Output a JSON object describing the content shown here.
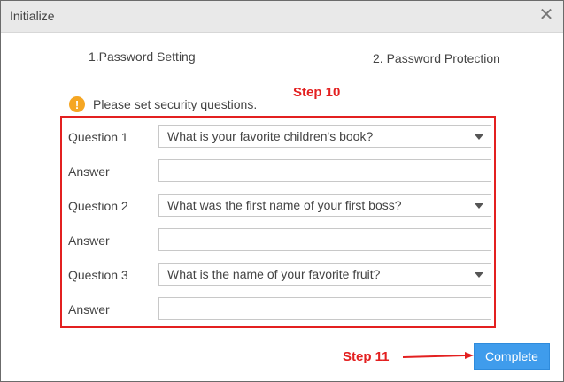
{
  "window": {
    "title": "Initialize",
    "close_icon": "close-icon"
  },
  "steps": {
    "step1_label": "1.Password Setting",
    "step2_label": "2. Password Protection"
  },
  "notice": {
    "icon": "warning-icon",
    "icon_glyph": "!",
    "text": "Please set security questions."
  },
  "annotations": {
    "step10": "Step 10",
    "step11": "Step 11",
    "color": "#e32020"
  },
  "questions": [
    {
      "label": "Question 1",
      "selected": "What is your favorite children's book?",
      "answer_label": "Answer",
      "answer_value": ""
    },
    {
      "label": "Question 2",
      "selected": "What was the first name of your first boss?",
      "answer_label": "Answer",
      "answer_value": ""
    },
    {
      "label": "Question 3",
      "selected": "What is the name of your favorite fruit?",
      "answer_label": "Answer",
      "answer_value": ""
    }
  ],
  "footer": {
    "complete_label": "Complete",
    "accent_color": "#3f9cec"
  }
}
